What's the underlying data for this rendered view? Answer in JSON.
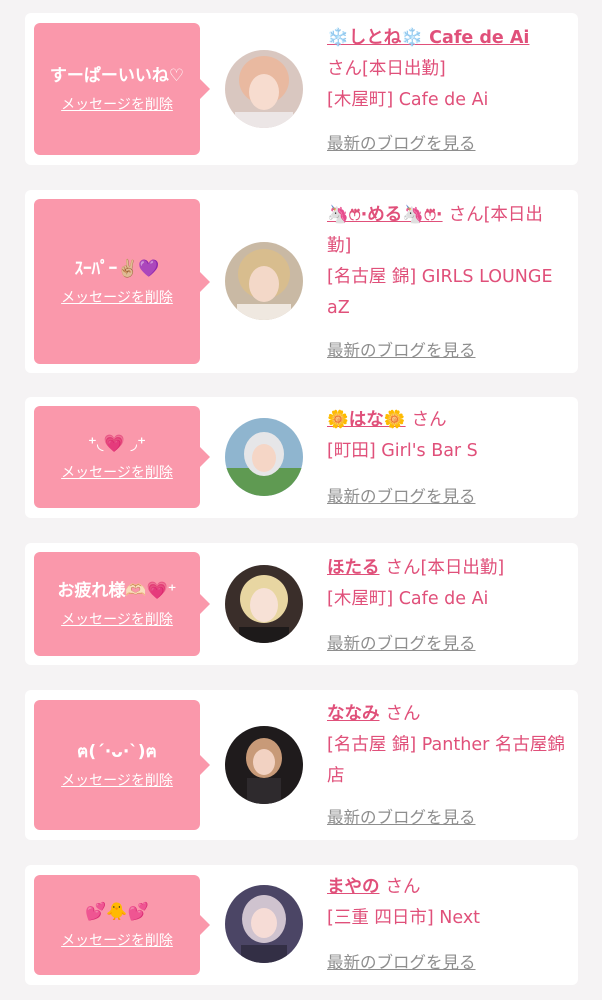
{
  "cards": [
    {
      "message": "すーぱーいいね♡",
      "delete_label": "メッセージを削除",
      "name": "❄️しとね❄️ Cafe de Ai",
      "honorific": "さん",
      "shop_line": "[本日出勤]",
      "shop_line2": "[木屋町] Cafe de Ai",
      "blog_label": "最新のブログを見る"
    },
    {
      "message": "ｽｰﾊﾟｰ✌🏼💜",
      "delete_label": "メッセージを削除",
      "name": "🦄ෆ⃛·める🦄ෆ⃛·",
      "honorific": "さん",
      "shop_line": "[本日出勤]",
      "shop_line2": "[名古屋 錦] GIRLS LOUNGE aZ",
      "blog_label": "最新のブログを見る"
    },
    {
      "message": "⁺◟💗 ◞⁺",
      "delete_label": "メッセージを削除",
      "name": "🌼はな🌼",
      "honorific": "さん",
      "shop_line": "",
      "shop_line2": "[町田] Girl's Bar S",
      "blog_label": "最新のブログを見る"
    },
    {
      "message": "お疲れ様🫶🏻💗⁺",
      "delete_label": "メッセージを削除",
      "name": "ほたる",
      "honorific": "さん",
      "shop_line": "[本日出勤]",
      "shop_line2": "[木屋町] Cafe de Ai",
      "blog_label": "最新のブログを見る"
    },
    {
      "message": "ฅ(ˊ·ᴗ·ˋ)ฅ",
      "delete_label": "メッセージを削除",
      "name": "ななみ",
      "honorific": "さん",
      "shop_line": "",
      "shop_line2": "[名古屋 錦] Panther 名古屋錦店",
      "blog_label": "最新のブログを見る"
    },
    {
      "message": "💕🐥💕",
      "delete_label": "メッセージを削除",
      "name": "まやの",
      "honorific": "さん",
      "shop_line": "",
      "shop_line2": "[三重 四日市] Next",
      "blog_label": "最新のブログを見る"
    }
  ]
}
